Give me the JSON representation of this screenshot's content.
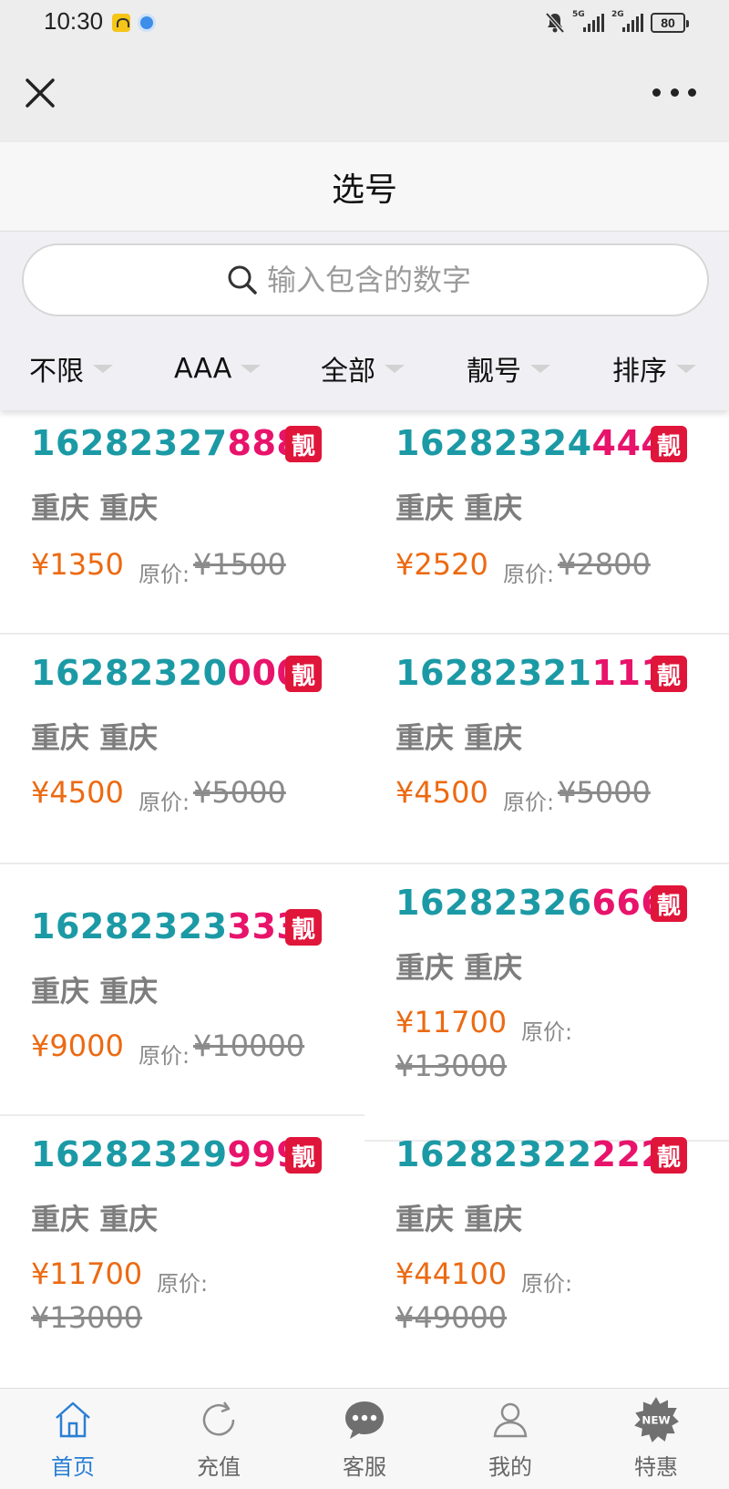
{
  "status_bar": {
    "time": "10:30",
    "network_1": "5G",
    "network_2": "2G",
    "battery": "80"
  },
  "top_bar": {
    "close_icon": "close-icon",
    "more_icon": "more-dots-icon"
  },
  "page": {
    "title": "选号"
  },
  "search": {
    "placeholder": "输入包含的数字"
  },
  "filters": [
    {
      "label": "不限"
    },
    {
      "label": "AAA"
    },
    {
      "label": "全部"
    },
    {
      "label": "靓号"
    },
    {
      "label": "排序"
    }
  ],
  "listings": [
    {
      "main": "16282327",
      "tail": "888",
      "badge": "靓",
      "region": "重庆 重庆",
      "price": "¥1350",
      "orig_label": "原价:",
      "orig_price": "¥1500"
    },
    {
      "main": "16282324",
      "tail": "444",
      "badge": "靓",
      "region": "重庆 重庆",
      "price": "¥2520",
      "orig_label": "原价:",
      "orig_price": "¥2800"
    },
    {
      "main": "16282320",
      "tail": "000",
      "badge": "靓",
      "region": "重庆 重庆",
      "price": "¥4500",
      "orig_label": "原价:",
      "orig_price": "¥5000"
    },
    {
      "main": "16282321",
      "tail": "111",
      "badge": "靓",
      "region": "重庆 重庆",
      "price": "¥4500",
      "orig_label": "原价:",
      "orig_price": "¥5000"
    },
    {
      "main": "16282323",
      "tail": "333",
      "badge": "靓",
      "region": "重庆 重庆",
      "price": "¥9000",
      "orig_label": "原价:",
      "orig_price": "¥10000"
    },
    {
      "main": "16282326",
      "tail": "666",
      "badge": "靓",
      "region": "重庆 重庆",
      "price": "¥11700",
      "orig_label": "原价:",
      "orig_price": "¥13000"
    },
    {
      "main": "16282329",
      "tail": "999",
      "badge": "靓",
      "region": "重庆 重庆",
      "price": "¥11700",
      "orig_label": "原价:",
      "orig_price": "¥13000"
    },
    {
      "main": "16282322",
      "tail": "222",
      "badge": "靓",
      "region": "重庆 重庆",
      "price": "¥44100",
      "orig_label": "原价:",
      "orig_price": "¥49000"
    }
  ],
  "tabs": [
    {
      "label": "首页",
      "icon": "home-icon",
      "active": true
    },
    {
      "label": "充值",
      "icon": "refresh-icon",
      "active": false
    },
    {
      "label": "客服",
      "icon": "chat-icon",
      "active": false
    },
    {
      "label": "我的",
      "icon": "user-icon",
      "active": false
    },
    {
      "label": "特惠",
      "icon": "new-badge-icon",
      "active": false,
      "badge_text": "NEW"
    }
  ],
  "colors": {
    "number_main": "#1b9aa5",
    "number_tail": "#e8136b",
    "badge": "#e0153a",
    "price": "#ec6a12",
    "tab_active": "#2a7fd4"
  }
}
